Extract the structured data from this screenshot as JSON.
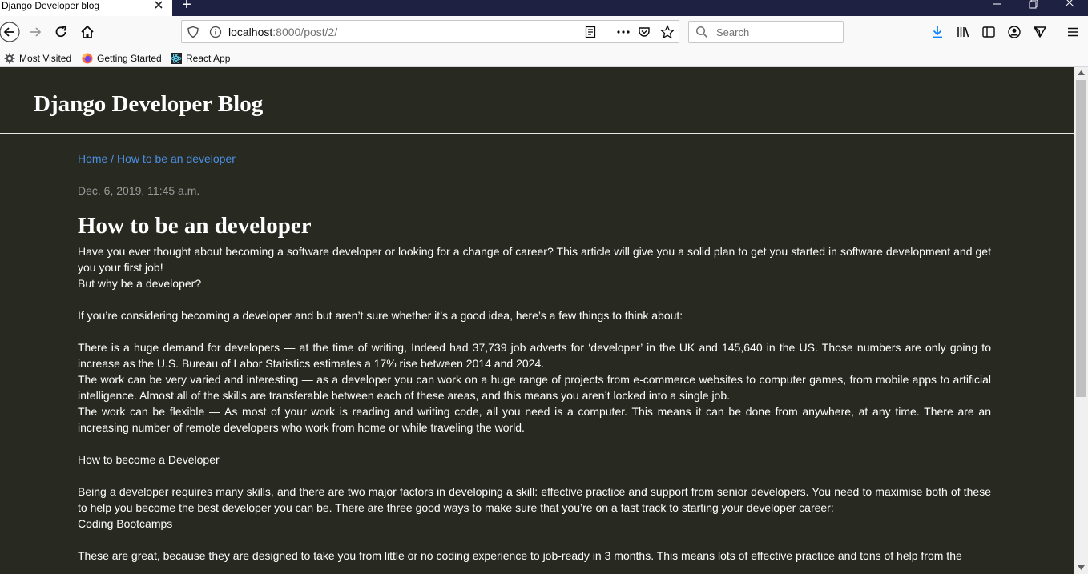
{
  "browser": {
    "tab_title": "Django Developer blog",
    "url_host": "localhost",
    "url_rest": ":8000/post/2/",
    "search_placeholder": "Search",
    "bookmarks": [
      "Most Visited",
      "Getting Started",
      "React App"
    ]
  },
  "site": {
    "title": "Django Developer Blog"
  },
  "breadcrumb": {
    "home": "Home",
    "separator": " / ",
    "current": "How to be an developer"
  },
  "post": {
    "date": "Dec. 6, 2019, 11:45 a.m.",
    "title": "How to be an developer",
    "p1": "Have you ever thought about becoming a software developer or looking for a change of career? This article will give you a solid plan to get you started in software development and get you your first job!",
    "p2": "But why be a developer?",
    "p3": "If you’re considering becoming a developer and but aren’t sure whether it’s a good idea, here’s a few things to think about:",
    "p4": "There is a huge demand for developers — at the time of writing, Indeed had 37,739 job adverts for ‘developer’ in the UK and 145,640 in the US. Those numbers are only going to increase as the U.S. Bureau of Labor Statistics estimates a 17% rise between 2014 and 2024.",
    "p5": "The work can be very varied and interesting — as a developer you can work on a huge range of projects from e-commerce websites to computer games, from mobile apps to artificial intelligence. Almost all of the skills are transferable between each of these areas, and this means you aren’t locked into a single job.",
    "p6": "The work can be flexible — As most of your work is reading and writing code, all you need is a computer. This means it can be done from anywhere, at any time. There are an increasing number of remote developers who work from home or while traveling the world.",
    "p7": "How to become a Developer",
    "p8": "Being a developer requires many skills, and there are two major factors in developing a skill: effective practice and support from senior developers. You need to maximise both of these to help you become the best developer you can be. There are three good ways to make sure that you’re on a fast track to starting your developer career:",
    "p9": "Coding Bootcamps",
    "p10": "These are great, because they are designed to take you from little or no coding experience to job-ready in 3 months. This means lots of effective practice and tons of help from the"
  }
}
